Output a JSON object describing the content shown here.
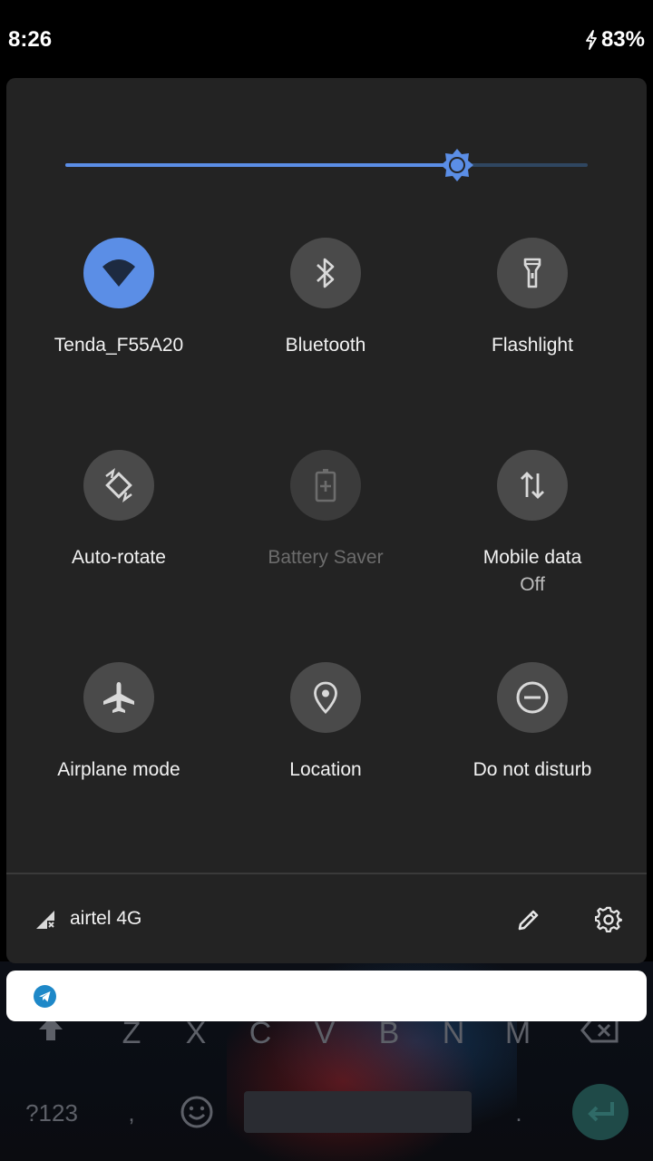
{
  "status_bar": {
    "time": "8:26",
    "battery": "83%"
  },
  "brightness": {
    "level": 0.75,
    "accent": "#5b8ee6"
  },
  "tiles": [
    {
      "label": "Tenda_F55A20",
      "icon": "wifi-icon",
      "state": "on"
    },
    {
      "label": "Bluetooth",
      "icon": "bluetooth-icon",
      "state": "off"
    },
    {
      "label": "Flashlight",
      "icon": "flashlight-icon",
      "state": "off"
    },
    {
      "label": "Auto-rotate",
      "icon": "auto-rotate-icon",
      "state": "off"
    },
    {
      "label": "Battery Saver",
      "icon": "battery-saver-icon",
      "state": "unavailable"
    },
    {
      "label": "Mobile data",
      "sublabel": "Off",
      "icon": "mobile-data-icon",
      "state": "off"
    },
    {
      "label": "Airplane mode",
      "icon": "airplane-icon",
      "state": "off"
    },
    {
      "label": "Location",
      "icon": "location-icon",
      "state": "off"
    },
    {
      "label": "Do not disturb",
      "icon": "do-not-disturb-icon",
      "state": "off"
    }
  ],
  "footer": {
    "carrier": "airtel 4G",
    "edit_icon": "pencil-icon",
    "settings_icon": "gear-icon"
  },
  "notification": {
    "app_icon": "telegram-icon"
  },
  "keyboard": {
    "row3": [
      "Z",
      "X",
      "C",
      "V",
      "B",
      "N",
      "M"
    ],
    "symbols_key": "?123",
    "comma_key": ",",
    "period_key": "."
  }
}
